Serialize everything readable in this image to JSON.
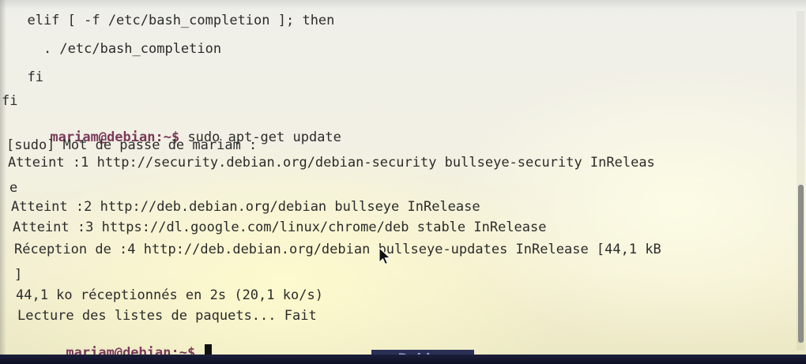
{
  "terminal": {
    "lines": [
      {
        "text": "  elif [ -f /etc/bash_completion ]; then"
      },
      {
        "text": "    . /etc/bash_completion"
      },
      {
        "text": "  fi"
      },
      {
        "text": "fi"
      },
      {
        "prompt": "mariam@debian",
        "path": ":~$",
        "command": " sudo apt-get update"
      },
      {
        "text": "[sudo] Mot de passe de mariam :"
      },
      {
        "text": "Atteint :1 http://security.debian.org/debian-security bullseye-security InReleas"
      },
      {
        "text": "e"
      },
      {
        "text": "Atteint :2 http://deb.debian.org/debian bullseye InRelease"
      },
      {
        "text": "Atteint :3 https://dl.google.com/linux/chrome/deb stable InRelease"
      },
      {
        "text": "Réception de :4 http://deb.debian.org/debian bullseye-updates InRelease [44,1 kB"
      },
      {
        "text": "]"
      },
      {
        "text": "44,1 ko réceptionnés en 2s (20,1 ko/s)"
      },
      {
        "text": "Lecture des listes de paquets... Fait"
      },
      {
        "prompt": "mariam@debian",
        "path": ":~$",
        "command": " "
      }
    ]
  },
  "colors": {
    "text": "#2b2b2b",
    "prompt_user": "#7a3a5a",
    "background": "#f2f0e4"
  },
  "desktop_peek_text": "Debian"
}
